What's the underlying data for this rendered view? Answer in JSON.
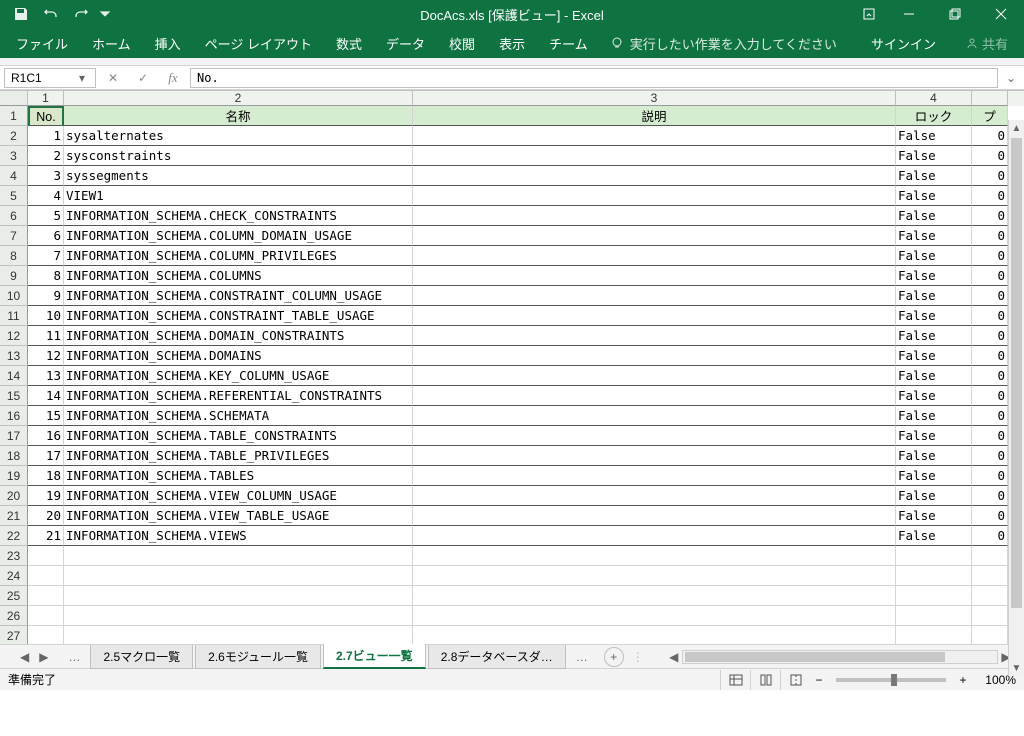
{
  "titlebar": {
    "title": "DocAcs.xls  [保護ビュー] - Excel"
  },
  "ribbon": {
    "tabs": [
      "ファイル",
      "ホーム",
      "挿入",
      "ページ レイアウト",
      "数式",
      "データ",
      "校閲",
      "表示",
      "チーム"
    ],
    "tellme": "実行したい作業を入力してください",
    "signin": "サインイン",
    "share": "共有"
  },
  "formula": {
    "name_box": "R1C1",
    "value": "No."
  },
  "columns": {
    "numbers": [
      "1",
      "2",
      "3",
      "4"
    ],
    "headers": [
      "No.",
      "名称",
      "説明",
      "ロック",
      "プ"
    ]
  },
  "rows": [
    {
      "no": "1",
      "name": "sysalternates",
      "lock": "False",
      "p": "0"
    },
    {
      "no": "2",
      "name": "sysconstraints",
      "lock": "False",
      "p": "0"
    },
    {
      "no": "3",
      "name": "syssegments",
      "lock": "False",
      "p": "0"
    },
    {
      "no": "4",
      "name": "VIEW1",
      "lock": "False",
      "p": "0"
    },
    {
      "no": "5",
      "name": "INFORMATION_SCHEMA.CHECK_CONSTRAINTS",
      "lock": "False",
      "p": "0"
    },
    {
      "no": "6",
      "name": "INFORMATION_SCHEMA.COLUMN_DOMAIN_USAGE",
      "lock": "False",
      "p": "0"
    },
    {
      "no": "7",
      "name": "INFORMATION_SCHEMA.COLUMN_PRIVILEGES",
      "lock": "False",
      "p": "0"
    },
    {
      "no": "8",
      "name": "INFORMATION_SCHEMA.COLUMNS",
      "lock": "False",
      "p": "0"
    },
    {
      "no": "9",
      "name": "INFORMATION_SCHEMA.CONSTRAINT_COLUMN_USAGE",
      "lock": "False",
      "p": "0"
    },
    {
      "no": "10",
      "name": "INFORMATION_SCHEMA.CONSTRAINT_TABLE_USAGE",
      "lock": "False",
      "p": "0"
    },
    {
      "no": "11",
      "name": "INFORMATION_SCHEMA.DOMAIN_CONSTRAINTS",
      "lock": "False",
      "p": "0"
    },
    {
      "no": "12",
      "name": "INFORMATION_SCHEMA.DOMAINS",
      "lock": "False",
      "p": "0"
    },
    {
      "no": "13",
      "name": "INFORMATION_SCHEMA.KEY_COLUMN_USAGE",
      "lock": "False",
      "p": "0"
    },
    {
      "no": "14",
      "name": "INFORMATION_SCHEMA.REFERENTIAL_CONSTRAINTS",
      "lock": "False",
      "p": "0"
    },
    {
      "no": "15",
      "name": "INFORMATION_SCHEMA.SCHEMATA",
      "lock": "False",
      "p": "0"
    },
    {
      "no": "16",
      "name": "INFORMATION_SCHEMA.TABLE_CONSTRAINTS",
      "lock": "False",
      "p": "0"
    },
    {
      "no": "17",
      "name": "INFORMATION_SCHEMA.TABLE_PRIVILEGES",
      "lock": "False",
      "p": "0"
    },
    {
      "no": "18",
      "name": "INFORMATION_SCHEMA.TABLES",
      "lock": "False",
      "p": "0"
    },
    {
      "no": "19",
      "name": "INFORMATION_SCHEMA.VIEW_COLUMN_USAGE",
      "lock": "False",
      "p": "0"
    },
    {
      "no": "20",
      "name": "INFORMATION_SCHEMA.VIEW_TABLE_USAGE",
      "lock": "False",
      "p": "0"
    },
    {
      "no": "21",
      "name": "INFORMATION_SCHEMA.VIEWS",
      "lock": "False",
      "p": "0"
    }
  ],
  "empty_rows": [
    "23",
    "24",
    "25",
    "26",
    "27"
  ],
  "sheets": {
    "ellipsis": "…",
    "tabs": [
      "2.5マクロ一覧",
      "2.6モジュール一覧",
      "2.7ビュー一覧",
      "2.8データベースダ…"
    ],
    "active_index": 2
  },
  "status": {
    "left": "準備完了",
    "zoom": "100%"
  }
}
